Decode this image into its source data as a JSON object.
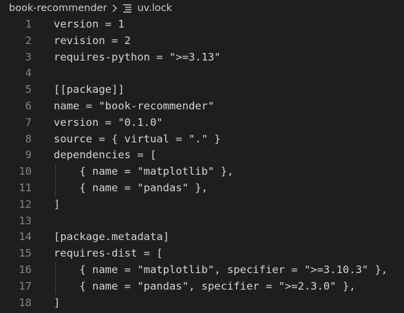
{
  "breadcrumb": {
    "folder": "book-recommender",
    "separator_icon": "chevron-right-icon",
    "file_icon": "list-lines-icon",
    "file": "uv.lock"
  },
  "colors": {
    "background": "#1e1e1e",
    "text": "#d4d4d4",
    "line_number": "#858585",
    "indent_guide": "#404040"
  },
  "code": {
    "lines": [
      {
        "num": "1",
        "text": "version = 1"
      },
      {
        "num": "2",
        "text": "revision = 2"
      },
      {
        "num": "3",
        "text": "requires-python = \">=3.13\""
      },
      {
        "num": "4",
        "text": ""
      },
      {
        "num": "5",
        "text": "[[package]]"
      },
      {
        "num": "6",
        "text": "name = \"book-recommender\""
      },
      {
        "num": "7",
        "text": "version = \"0.1.0\""
      },
      {
        "num": "8",
        "text": "source = { virtual = \".\" }"
      },
      {
        "num": "9",
        "text": "dependencies = ["
      },
      {
        "num": "10",
        "text": "    { name = \"matplotlib\" },"
      },
      {
        "num": "11",
        "text": "    { name = \"pandas\" },"
      },
      {
        "num": "12",
        "text": "]"
      },
      {
        "num": "13",
        "text": ""
      },
      {
        "num": "14",
        "text": "[package.metadata]"
      },
      {
        "num": "15",
        "text": "requires-dist = ["
      },
      {
        "num": "16",
        "text": "    { name = \"matplotlib\", specifier = \">=3.10.3\" },"
      },
      {
        "num": "17",
        "text": "    { name = \"pandas\", specifier = \">=2.3.0\" },"
      },
      {
        "num": "18",
        "text": "]"
      }
    ]
  }
}
